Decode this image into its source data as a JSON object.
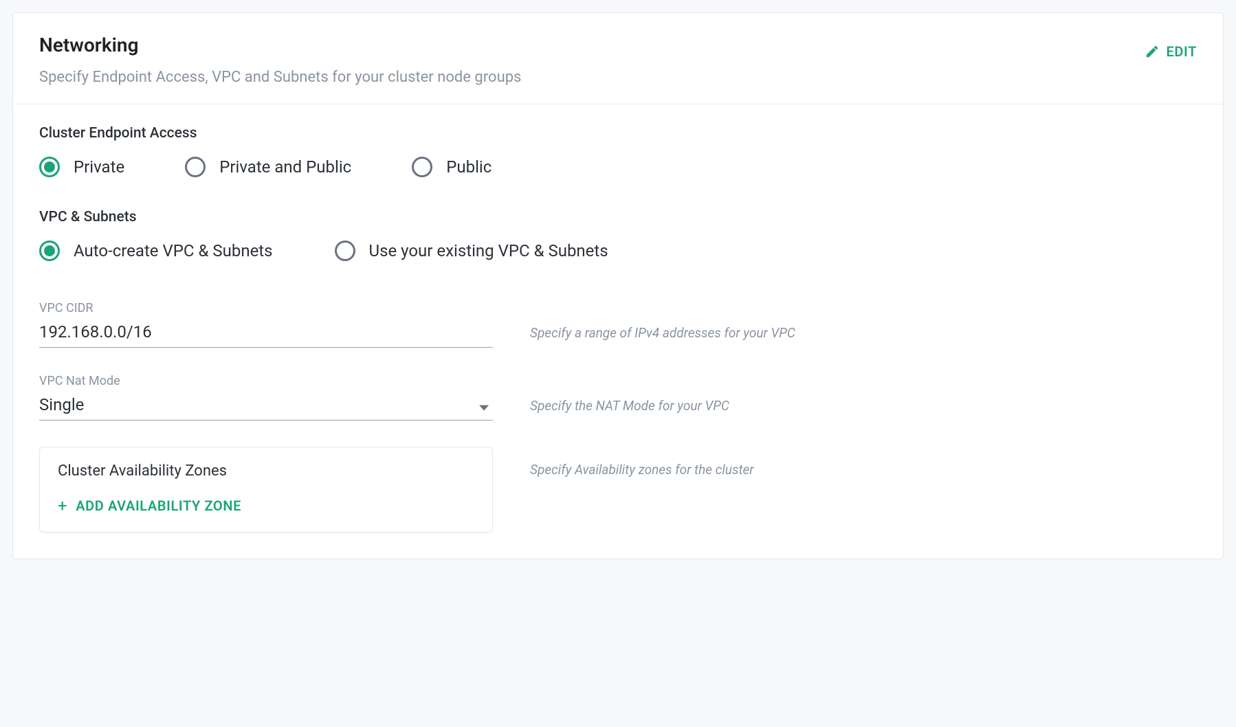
{
  "header": {
    "title": "Networking",
    "subtitle": "Specify Endpoint Access, VPC and Subnets for your cluster node groups",
    "edit_label": "EDIT"
  },
  "endpoint_access": {
    "label": "Cluster Endpoint Access",
    "options": {
      "private": "Private",
      "private_public": "Private and Public",
      "public": "Public"
    },
    "selected": "private"
  },
  "vpc_subnets": {
    "label": "VPC & Subnets",
    "options": {
      "auto": "Auto-create VPC & Subnets",
      "existing": "Use your existing VPC & Subnets"
    },
    "selected": "auto"
  },
  "vpc_cidr": {
    "label": "VPC CIDR",
    "value": "192.168.0.0/16",
    "help": "Specify a range of IPv4 addresses for your VPC"
  },
  "vpc_nat": {
    "label": "VPC Nat Mode",
    "value": "Single",
    "help": "Specify the NAT Mode for your VPC"
  },
  "az": {
    "title": "Cluster Availability Zones",
    "add_label": "ADD  AVAILABILITY ZONE",
    "help": "Specify Availability zones for the cluster"
  }
}
